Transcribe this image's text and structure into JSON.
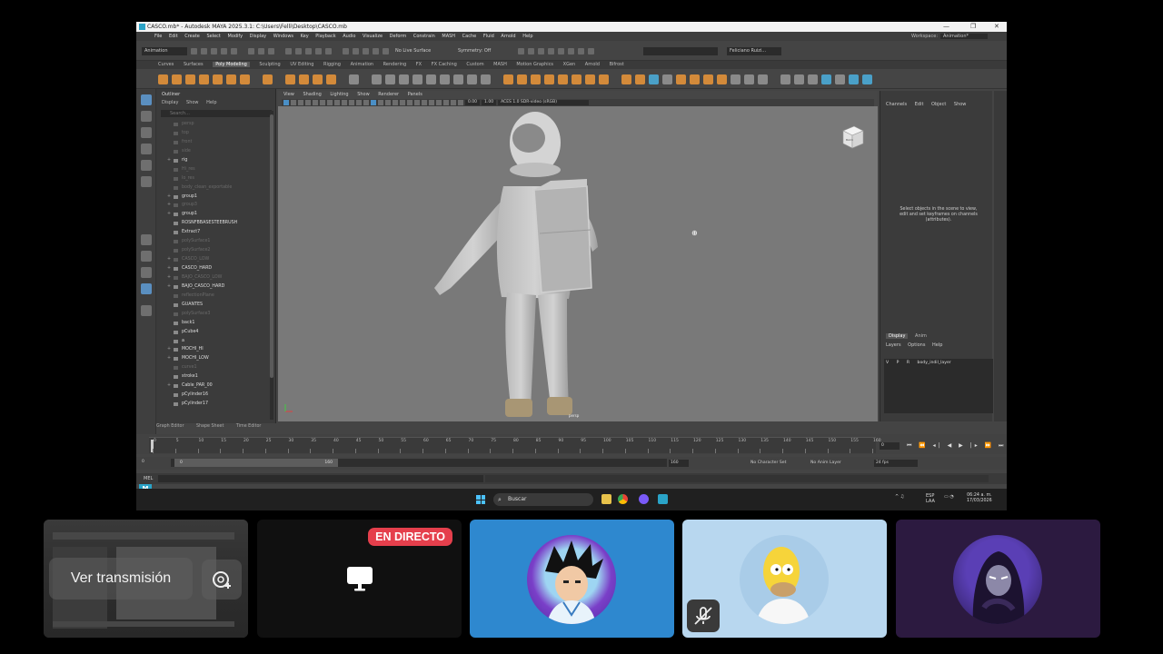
{
  "window": {
    "title": "CASCO.mb* - Autodesk MAYA 2025.3.1: C:\\Users\\Felli\\Desktop\\CASCO.mb",
    "controls": [
      "—",
      "❐",
      "✕"
    ]
  },
  "menubar": {
    "items": [
      "File",
      "Edit",
      "Create",
      "Select",
      "Modify",
      "Display",
      "Windows",
      "Key",
      "Playback",
      "Audio",
      "Visualize",
      "Deform",
      "Constrain",
      "MASH",
      "Cache",
      "Fluid",
      "Arnold",
      "Help"
    ],
    "workspace_label": "Workspace:",
    "workspace_value": "Animation*"
  },
  "status_line": {
    "mode": "Animation",
    "live_surface": "No Live Surface",
    "symmetry": "Symmetry: Off",
    "user": "Feliciano Ruizi..."
  },
  "shelf": {
    "tabs": [
      "Curves",
      "Surfaces",
      "Poly Modeling",
      "Sculpting",
      "UV Editing",
      "Rigging",
      "Animation",
      "Rendering",
      "FX",
      "FX Caching",
      "Custom",
      "MASH",
      "Motion Graphics",
      "XGen",
      "Arnold",
      "Bifrost"
    ],
    "active_tab": "Poly Modeling"
  },
  "outliner": {
    "title": "Outliner",
    "menu": [
      "Display",
      "Show",
      "Help"
    ],
    "search_placeholder": "Search...",
    "items": [
      {
        "label": "persp",
        "dim": true,
        "expand": ""
      },
      {
        "label": "top",
        "dim": true,
        "expand": ""
      },
      {
        "label": "front",
        "dim": true,
        "expand": ""
      },
      {
        "label": "side",
        "dim": true,
        "expand": ""
      },
      {
        "label": "rig",
        "dim": false,
        "expand": "+"
      },
      {
        "label": "Hi_res",
        "dim": true,
        "expand": ""
      },
      {
        "label": "lo_res",
        "dim": true,
        "expand": ""
      },
      {
        "label": "body_clean_exportable",
        "dim": true,
        "expand": ""
      },
      {
        "label": "group1",
        "dim": false,
        "expand": "+"
      },
      {
        "label": "group3",
        "dim": true,
        "expand": "+"
      },
      {
        "label": "group1",
        "dim": false,
        "expand": "+"
      },
      {
        "label": "ROSNFBBASESTEEBRUSH",
        "dim": false,
        "expand": ""
      },
      {
        "label": "Extract7",
        "dim": false,
        "expand": ""
      },
      {
        "label": "polySurface1",
        "dim": true,
        "expand": ""
      },
      {
        "label": "polySurface2",
        "dim": true,
        "expand": ""
      },
      {
        "label": "CASCO_LOW",
        "dim": true,
        "expand": "+"
      },
      {
        "label": "CASCO_HARD",
        "dim": false,
        "expand": "+"
      },
      {
        "label": "BAJO_CASCO_LOW",
        "dim": true,
        "expand": "+"
      },
      {
        "label": "BAJO_CASCO_HARD",
        "dim": false,
        "expand": "+"
      },
      {
        "label": "reflectionPlane",
        "dim": true,
        "expand": ""
      },
      {
        "label": "GUANTES",
        "dim": false,
        "expand": ""
      },
      {
        "label": "polySurface3",
        "dim": true,
        "expand": ""
      },
      {
        "label": "back1",
        "dim": false,
        "expand": ""
      },
      {
        "label": "pCube4",
        "dim": false,
        "expand": ""
      },
      {
        "label": "a",
        "dim": false,
        "expand": ""
      },
      {
        "label": "MOCHI_HI",
        "dim": false,
        "expand": "+"
      },
      {
        "label": "MOCHI_LOW",
        "dim": false,
        "expand": "+"
      },
      {
        "label": "curve1",
        "dim": true,
        "expand": ""
      },
      {
        "label": "stroke1",
        "dim": false,
        "expand": ""
      },
      {
        "label": "Cable_PAR_00",
        "dim": false,
        "expand": "+"
      },
      {
        "label": "pCylinder16",
        "dim": false,
        "expand": ""
      },
      {
        "label": "pCylinder17",
        "dim": false,
        "expand": ""
      }
    ]
  },
  "viewport": {
    "menu": [
      "View",
      "Shading",
      "Lighting",
      "Show",
      "Renderer",
      "Panels"
    ],
    "field1": "0.00",
    "field2": "1.00",
    "colorspace": "ACES 1.0 SDR-video (sRGB)",
    "cube_label": "BACK",
    "camera_label": "persp"
  },
  "channel_box": {
    "menu": [
      "Channels",
      "Edit",
      "Object",
      "Show"
    ],
    "message": "Select objects in the scene to view, edit and set keyframes on channels (attributes)."
  },
  "layer_editor": {
    "tabs": [
      "Display",
      "Anim"
    ],
    "menu": [
      "Layers",
      "Options",
      "Help"
    ],
    "layer_vpr": [
      "V",
      "P",
      "R"
    ],
    "layer_name": "body_indil_layer"
  },
  "bottom_tabs": [
    "Graph Editor",
    "Shape Sheet",
    "Time Editor"
  ],
  "timeline": {
    "ticks": [
      "0",
      "5",
      "10",
      "15",
      "20",
      "25",
      "30",
      "35",
      "40",
      "45",
      "50",
      "55",
      "60",
      "65",
      "70",
      "75",
      "80",
      "85",
      "90",
      "95",
      "100",
      "105",
      "110",
      "115",
      "120",
      "125",
      "130",
      "135",
      "140",
      "145",
      "150",
      "155",
      "160"
    ],
    "current_frame": "0",
    "playback_controls": "⏮ ⏪ ◂| ◀ ▶ |▸ ⏩ ⏭"
  },
  "range": {
    "start": "0",
    "inner_start": "0",
    "inner_end": "160",
    "end": "160",
    "character_set": "No Character Set",
    "anim_layer": "No Anim Layer",
    "fps": "24 fps"
  },
  "command_line": {
    "label": "MEL"
  },
  "taskbar": {
    "search_label": "Buscar",
    "tray_lang": "ESP\nLAA",
    "time": "06:24 a. m.",
    "date": "17/03/2026"
  },
  "tiles": {
    "watch_button": "Ver transmisión",
    "live_badge": "EN DIRECTO"
  },
  "colors": {
    "maya_accent": "#2aa3c7",
    "live_red": "#e53f4c",
    "shelf_orange": "#d38a3a",
    "tile_blue": "#2e88cf",
    "tile_lightblue": "#b8d7ef",
    "tile_purple": "#2c1a40"
  }
}
